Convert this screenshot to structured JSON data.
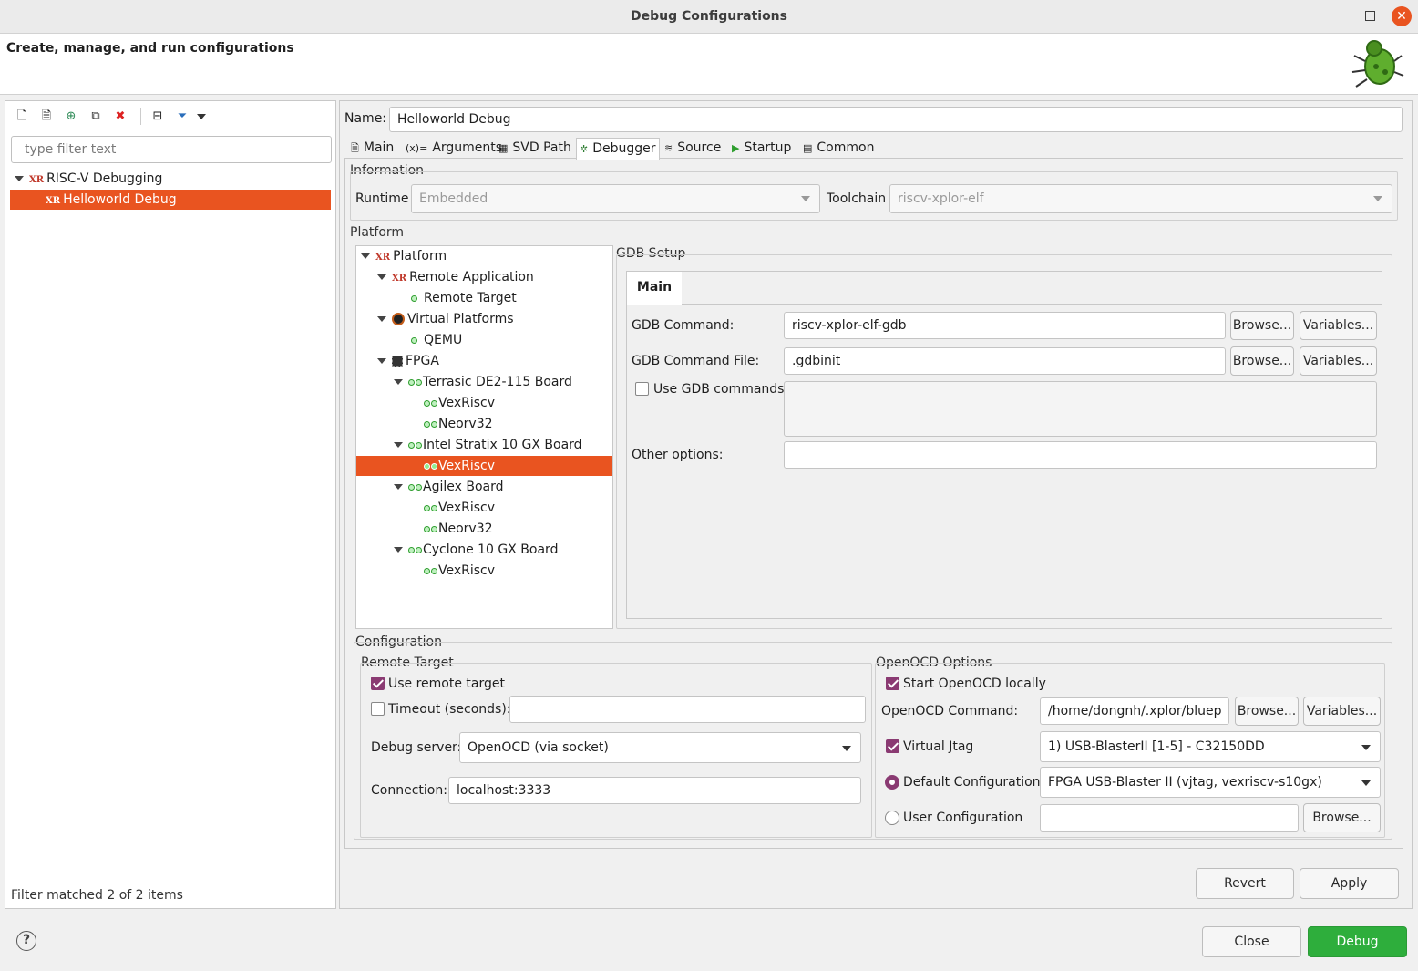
{
  "window": {
    "title": "Debug Configurations"
  },
  "header": {
    "title": "Create, manage, and run configurations"
  },
  "left": {
    "filter_placeholder": "type filter text",
    "tree": [
      {
        "label": "RISC-V Debugging",
        "icon": "xr-icon"
      },
      {
        "label": "Helloworld Debug",
        "icon": "xr-icon",
        "selected": true
      }
    ],
    "status": "Filter matched 2 of 2 items"
  },
  "name": {
    "label": "Name:",
    "value": "Helloworld Debug"
  },
  "tabs": [
    {
      "label": "Main",
      "icon": "page-icon"
    },
    {
      "label": "Arguments",
      "icon": "args-icon"
    },
    {
      "label": "SVD Path",
      "icon": "grid-icon"
    },
    {
      "label": "Debugger",
      "icon": "bug-icon",
      "active": true
    },
    {
      "label": "Source",
      "icon": "source-icon"
    },
    {
      "label": "Startup",
      "icon": "play-icon"
    },
    {
      "label": "Common",
      "icon": "table-icon"
    }
  ],
  "information": {
    "title": "Information",
    "runtime_label": "Runtime",
    "runtime_value": "Embedded",
    "toolchain_label": "Toolchain",
    "toolchain_value": "riscv-xplor-elf"
  },
  "platform": {
    "title": "Platform",
    "tree": [
      "Platform",
      "Remote Application",
      "Remote Target",
      "Virtual Platforms",
      "QEMU",
      "FPGA",
      "Terrasic DE2-115 Board",
      "VexRiscv",
      "Neorv32",
      "Intel Stratix 10 GX Board",
      "VexRiscv",
      "Agilex Board",
      "VexRiscv",
      "Neorv32",
      "Cyclone 10 GX Board",
      "VexRiscv"
    ]
  },
  "gdb": {
    "title": "GDB Setup",
    "tab": "Main",
    "command_label": "GDB Command:",
    "command_value": "riscv-xplor-elf-gdb",
    "file_label": "GDB Command File:",
    "file_value": ".gdbinit",
    "use_cmds_label": "Use GDB commands:",
    "other_label": "Other options:",
    "browse": "Browse...",
    "variables": "Variables..."
  },
  "configuration": {
    "title": "Configuration",
    "remote": {
      "title": "Remote Target",
      "use_remote": "Use remote target",
      "timeout": "Timeout (seconds):",
      "debug_server_label": "Debug server:",
      "debug_server_value": "OpenOCD (via socket)",
      "connection_label": "Connection:",
      "connection_value": "localhost:3333"
    },
    "openocd": {
      "title": "OpenOCD Options",
      "start_locally": "Start OpenOCD locally",
      "command_label": "OpenOCD Command:",
      "command_value": "/home/dongnh/.xplor/bluep",
      "vjtag_label": "Virtual Jtag",
      "vjtag_value": "1) USB-BlasterII [1-5] - C32150DD",
      "default_cfg_label": "Default Configuration",
      "default_cfg_value": "FPGA USB-Blaster II (vjtag, vexriscv-s10gx)",
      "user_cfg_label": "User Configuration"
    }
  },
  "buttons": {
    "revert": "Revert",
    "apply": "Apply",
    "close": "Close",
    "debug": "Debug",
    "help": "?"
  }
}
